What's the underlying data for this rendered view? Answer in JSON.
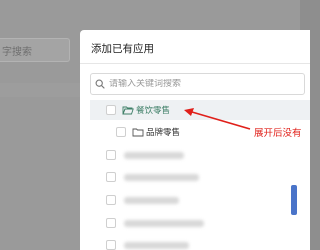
{
  "background": {
    "search_placeholder": "字搜索"
  },
  "dialog": {
    "title": "添加已有应用",
    "search_placeholder": "请输入关键词搜索"
  },
  "tree": {
    "nodes": [
      {
        "label": "餐饮零售",
        "expanded": true,
        "selected": true
      },
      {
        "label": "品牌零售",
        "expanded": false,
        "selected": false
      }
    ]
  },
  "annotation": {
    "text": "展开后没有",
    "color": "#e0201a"
  },
  "colors": {
    "selected_node_text": "#3e7f67",
    "scroll_thumb": "#4a74c9"
  }
}
